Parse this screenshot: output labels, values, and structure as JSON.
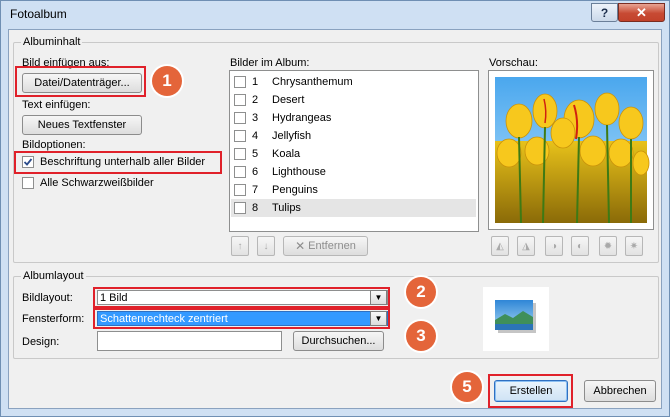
{
  "window": {
    "title": "Fotoalbum",
    "help_label": "?",
    "close_label": "✕"
  },
  "album_content": {
    "group_title": "Albuminhalt",
    "insert_from_label": "Bild einfügen aus:",
    "file_disk_button": "Datei/Datenträger...",
    "insert_text_label": "Text einfügen:",
    "new_textbox_button": "Neues Textfenster",
    "options_label": "Bildoptionen:",
    "captions_option": {
      "label": "Beschriftung unterhalb aller Bilder",
      "checked": true
    },
    "bw_option": {
      "label": "Alle Schwarzweißbilder",
      "checked": false
    }
  },
  "pictures_in_album": {
    "label": "Bilder im Album:",
    "items": [
      {
        "num": "1",
        "name": "Chrysanthemum"
      },
      {
        "num": "2",
        "name": "Desert"
      },
      {
        "num": "3",
        "name": "Hydrangeas"
      },
      {
        "num": "4",
        "name": "Jellyfish"
      },
      {
        "num": "5",
        "name": "Koala"
      },
      {
        "num": "6",
        "name": "Lighthouse"
      },
      {
        "num": "7",
        "name": "Penguins"
      },
      {
        "num": "8",
        "name": "Tulips"
      }
    ],
    "selected_index": 7,
    "remove_button": "Entfernen",
    "up_icon": "arrow-up-icon",
    "down_icon": "arrow-down-icon",
    "remove_icon": "x-icon"
  },
  "preview": {
    "label": "Vorschau:",
    "tool_icons": [
      "rotate-left-icon",
      "rotate-right-icon",
      "contrast-up-icon",
      "contrast-down-icon",
      "brightness-up-icon",
      "brightness-down-icon"
    ]
  },
  "album_layout": {
    "group_title": "Albumlayout",
    "picture_layout_label": "Bildlayout:",
    "picture_layout_value": "1 Bild",
    "frame_shape_label": "Fensterform:",
    "frame_shape_value": "Schattenrechteck zentriert",
    "design_label": "Design:",
    "design_value": "",
    "browse_button": "Durchsuchen..."
  },
  "footer": {
    "create_button": "Erstellen",
    "cancel_button": "Abbrechen"
  },
  "callouts": [
    "1",
    "2",
    "3",
    "4",
    "5"
  ],
  "colors": {
    "callout": "#e4653a",
    "highlight_box": "#e0212a",
    "selection": "#3399ff"
  }
}
